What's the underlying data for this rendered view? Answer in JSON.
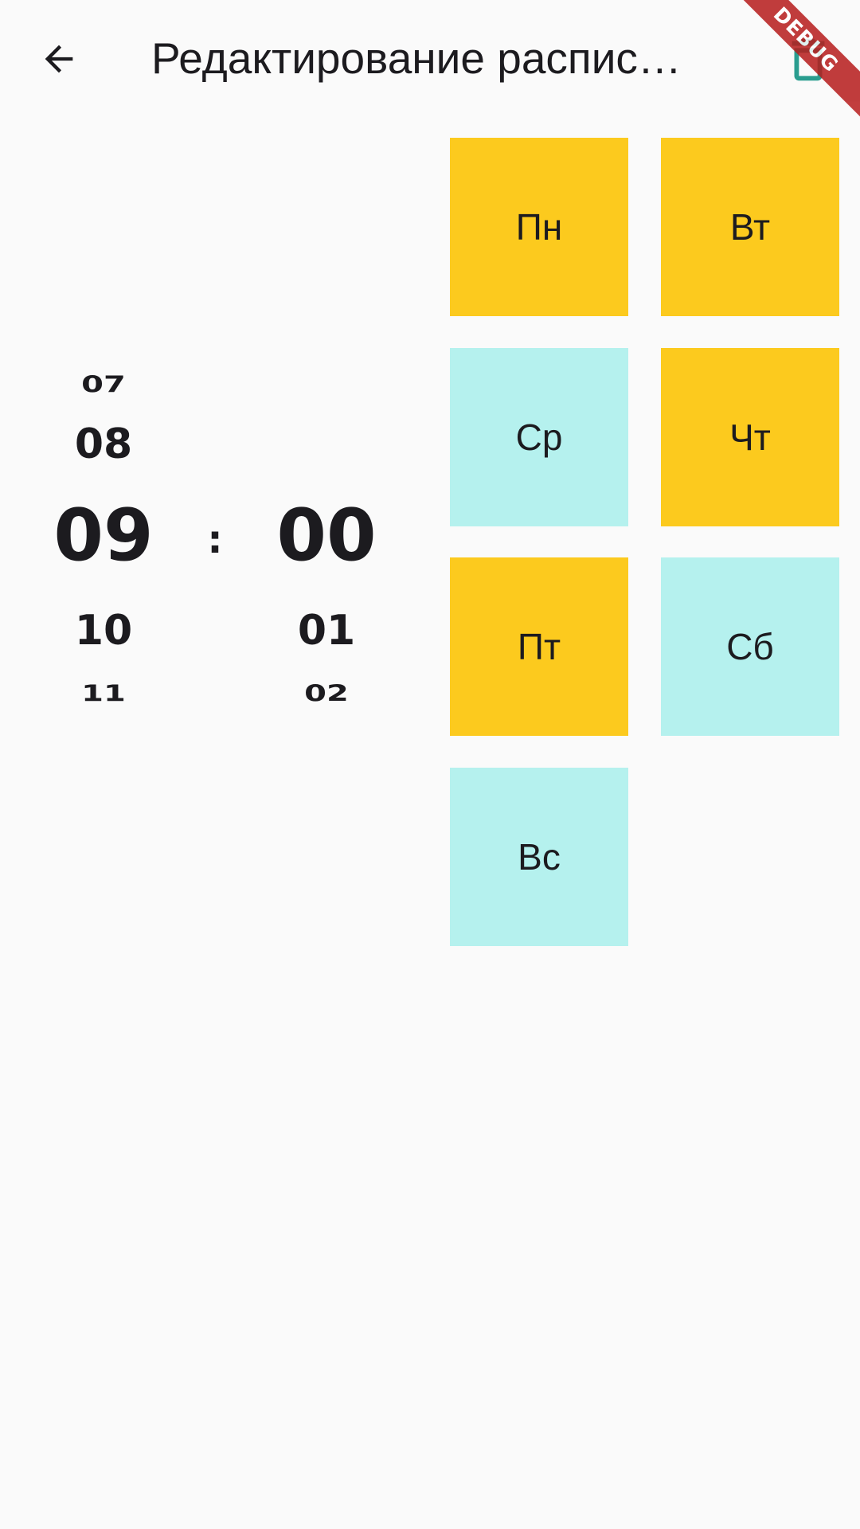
{
  "appbar": {
    "title": "Редактирование распис…",
    "back_icon": "arrow-back-icon",
    "action_icon": "delete-icon"
  },
  "debug_banner": "DEBUG",
  "picker": {
    "hours": [
      "07",
      "08",
      "09",
      "10",
      "11"
    ],
    "minutes": [
      "00",
      "01",
      "02"
    ],
    "selected_hour": "09",
    "selected_minute": "00",
    "separator": ":"
  },
  "days": [
    {
      "label": "Пн",
      "active": true
    },
    {
      "label": "Вт",
      "active": true
    },
    {
      "label": "Ср",
      "active": false
    },
    {
      "label": "Чт",
      "active": true
    },
    {
      "label": "Пт",
      "active": true
    },
    {
      "label": "Сб",
      "active": false
    },
    {
      "label": "Вс",
      "active": false
    }
  ],
  "colors": {
    "active_day": "#fcca1e",
    "inactive_day": "#b5f1ee",
    "action_icon": "#2a9d8f",
    "debug_ribbon": "#b71c1c"
  }
}
